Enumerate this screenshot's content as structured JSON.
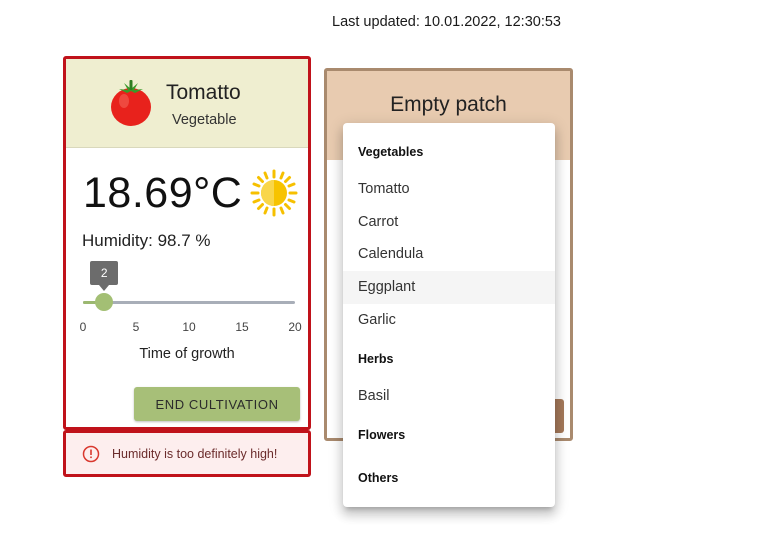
{
  "last_updated": "Last updated: 10.01.2022, 12:30:53",
  "plant_card": {
    "name": "Tomatto",
    "type": "Vegetable",
    "temperature": "18.69°C",
    "humidity": "Humidity: 98.7 %",
    "slider": {
      "value": 2,
      "min": 0,
      "max": 20,
      "tooltip": "2",
      "ticks": [
        "0",
        "5",
        "10",
        "15",
        "20"
      ],
      "label": "Time of growth"
    },
    "end_button": "END CULTIVATION",
    "accent_color": "#a7bf78",
    "border_color": "#c0121a"
  },
  "alert": {
    "text": "Humidity is too definitely high!"
  },
  "patch_card": {
    "title": "Empty patch",
    "header_color": "#e8cbb0"
  },
  "menu": {
    "groups": [
      {
        "label": "Vegetables",
        "items": [
          "Tomatto",
          "Carrot",
          "Calendula",
          "Eggplant",
          "Garlic"
        ]
      },
      {
        "label": "Herbs",
        "items": [
          "Basil"
        ]
      },
      {
        "label": "Flowers",
        "items": []
      },
      {
        "label": "Others",
        "items": []
      }
    ],
    "hovered_item": "Eggplant"
  }
}
